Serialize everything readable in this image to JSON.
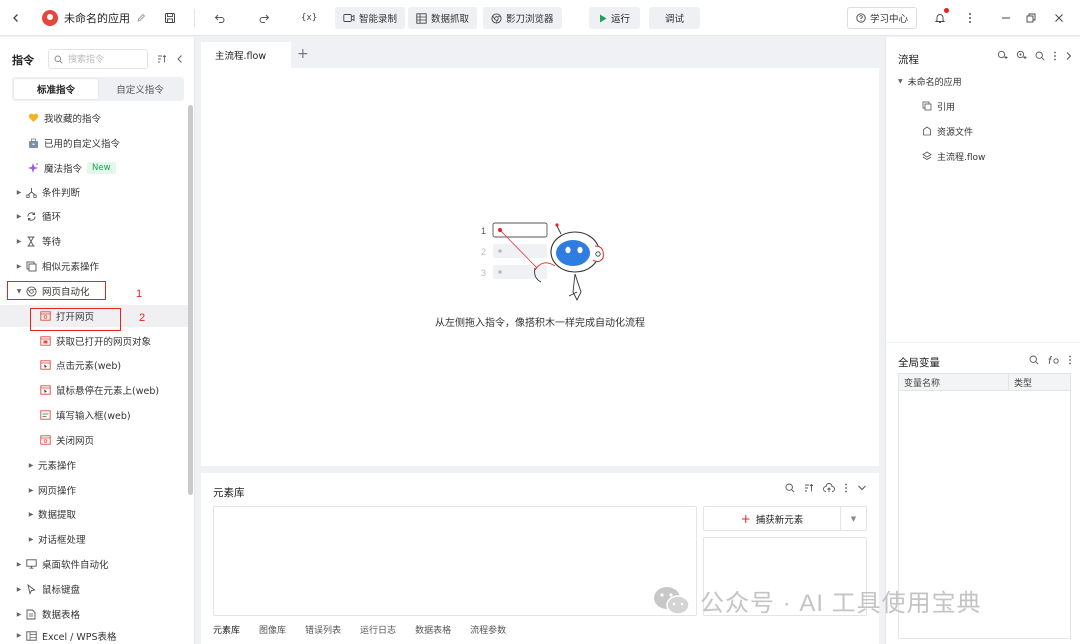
{
  "topbar": {
    "app_title": "未命名的应用",
    "record_label": "智能录制",
    "capture_label": "数据抓取",
    "browser_label": "影刀浏览器",
    "run_label": "运行",
    "debug_label": "调试",
    "learn_label": "学习中心",
    "variable_glyph": "{x}"
  },
  "left_panel": {
    "title": "指令",
    "search_placeholder": "搜索指令",
    "tabs": [
      "标准指令",
      "自定义指令"
    ],
    "active_tab": 0,
    "items": [
      {
        "label": "我收藏的指令",
        "icon": "heart-icon"
      },
      {
        "label": "已用的自定义指令",
        "icon": "briefcase-icon"
      },
      {
        "label": "魔法指令",
        "icon": "sparkle-icon",
        "badge": "New"
      },
      {
        "label": "条件判断",
        "icon": "branch-icon"
      },
      {
        "label": "循环",
        "icon": "loop-icon"
      },
      {
        "label": "等待",
        "icon": "hourglass-icon"
      },
      {
        "label": "相似元素操作",
        "icon": "similar-elements-icon"
      },
      {
        "label": "网页自动化",
        "icon": "globe-icon"
      },
      {
        "label": "打开网页",
        "icon": "open-page-icon"
      },
      {
        "label": "获取已打开的网页对象",
        "icon": "web-object-icon"
      },
      {
        "label": "点击元素(web)",
        "icon": "click-element-icon"
      },
      {
        "label": "鼠标悬停在元素上(web)",
        "icon": "hover-icon"
      },
      {
        "label": "填写输入框(web)",
        "icon": "input-field-icon"
      },
      {
        "label": "关闭网页",
        "icon": "close-page-icon"
      },
      {
        "label": "元素操作"
      },
      {
        "label": "网页操作"
      },
      {
        "label": "数据提取"
      },
      {
        "label": "对话框处理"
      },
      {
        "label": "桌面软件自动化",
        "icon": "monitor-icon"
      },
      {
        "label": "鼠标键盘",
        "icon": "mouse-pointer-icon"
      },
      {
        "label": "数据表格",
        "icon": "spreadsheet-icon"
      },
      {
        "label": "Excel / WPS表格",
        "icon": "excel-icon"
      }
    ],
    "annotations": [
      "1",
      "2"
    ]
  },
  "canvas": {
    "tab_label": "主流程.flow",
    "empty_hint": "从左侧拖入指令，像搭积木一样完成自动化流程",
    "illustration_numbers": [
      "1",
      "2",
      "3"
    ]
  },
  "element_library": {
    "title": "元素库",
    "capture_new": "捕获新元素",
    "bottom_tabs": [
      "元素库",
      "图像库",
      "错误列表",
      "运行日志",
      "数据表格",
      "流程参数"
    ]
  },
  "flow_panel": {
    "title": "流程",
    "app_name": "未命名的应用",
    "items": [
      "引用",
      "资源文件",
      "主流程.flow"
    ]
  },
  "vars_panel": {
    "title": "全局变量",
    "columns": [
      "变量名称",
      "类型"
    ]
  },
  "watermark": "公众号 · AI 工具使用宝典",
  "colors": {
    "accent_red": "#e5231f",
    "run_green": "#1aa35a",
    "robot_blue": "#2f7de1"
  }
}
